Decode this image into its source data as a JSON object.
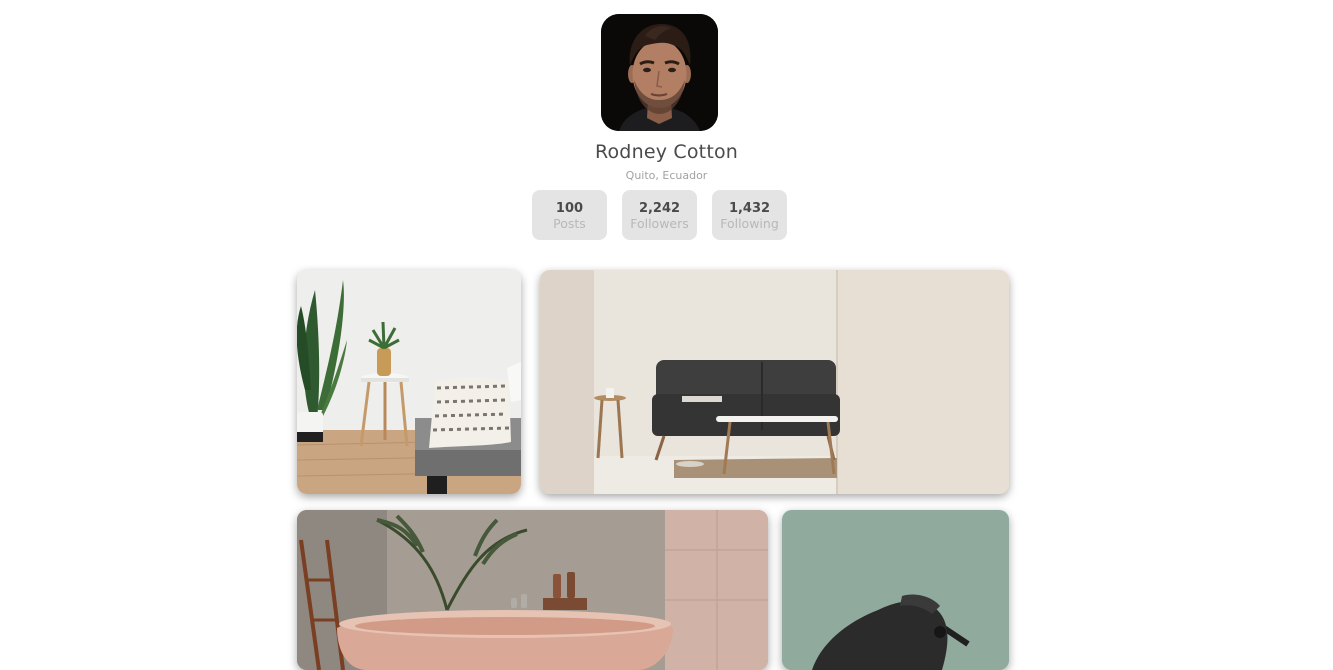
{
  "profile": {
    "name": "Rodney Cotton",
    "location": "Quito, Ecuador",
    "stats": [
      {
        "value": "100",
        "label": "Posts"
      },
      {
        "value": "2,242",
        "label": "Followers"
      },
      {
        "value": "1,432",
        "label": "Following"
      }
    ]
  },
  "gallery": {
    "photos": [
      {
        "subject": "living-room-plant-side-table"
      },
      {
        "subject": "living-room-dark-sofa"
      },
      {
        "subject": "bathroom-pink-bathtub"
      },
      {
        "subject": "green-wall-black-lamp"
      }
    ]
  },
  "colors": {
    "name_text": "#4a4a4a",
    "secondary_text": "#a2a2a2",
    "stat_background": "#e4e4e4"
  }
}
